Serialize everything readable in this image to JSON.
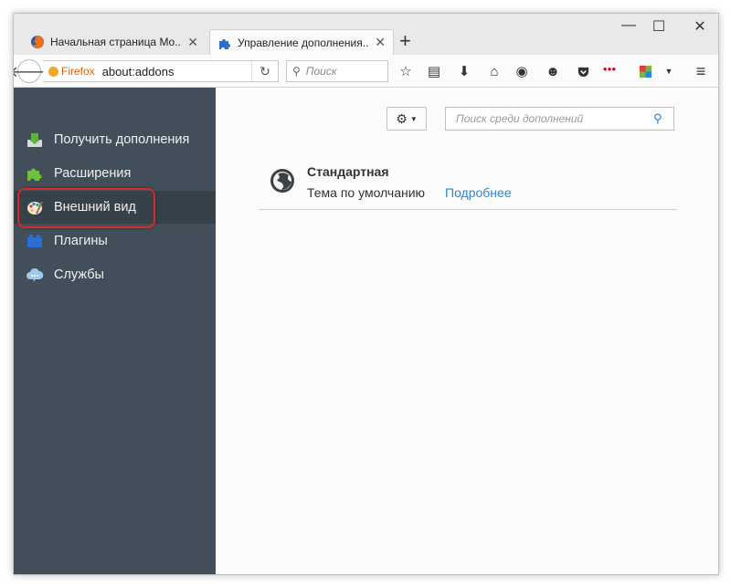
{
  "tabs": [
    {
      "label": "Начальная страница Mo...",
      "active": false
    },
    {
      "label": "Управление дополнения...",
      "active": true
    }
  ],
  "window_controls": {
    "minimize": "—",
    "maximize": "☐",
    "close": "✕"
  },
  "navbar": {
    "identity_label": "Firefox",
    "url": "about:addons",
    "search_placeholder": "Поиск"
  },
  "sidebar": {
    "items": [
      {
        "label": "Получить дополнения",
        "icon": "get-addons-icon"
      },
      {
        "label": "Расширения",
        "icon": "puzzle-icon"
      },
      {
        "label": "Внешний вид",
        "icon": "palette-icon",
        "selected": true
      },
      {
        "label": "Плагины",
        "icon": "lego-block-icon"
      },
      {
        "label": "Службы",
        "icon": "services-cloud-icon"
      }
    ]
  },
  "content": {
    "search_placeholder": "Поиск среди дополнений",
    "theme": {
      "name": "Стандартная",
      "description": "Тема по умолчанию",
      "more_link": "Подробнее"
    }
  },
  "colors": {
    "sidebar_bg": "#424f5a",
    "sidebar_selected": "#36414a",
    "highlight": "#d72a2a",
    "link": "#2b88cf",
    "identity": "#e66000"
  }
}
